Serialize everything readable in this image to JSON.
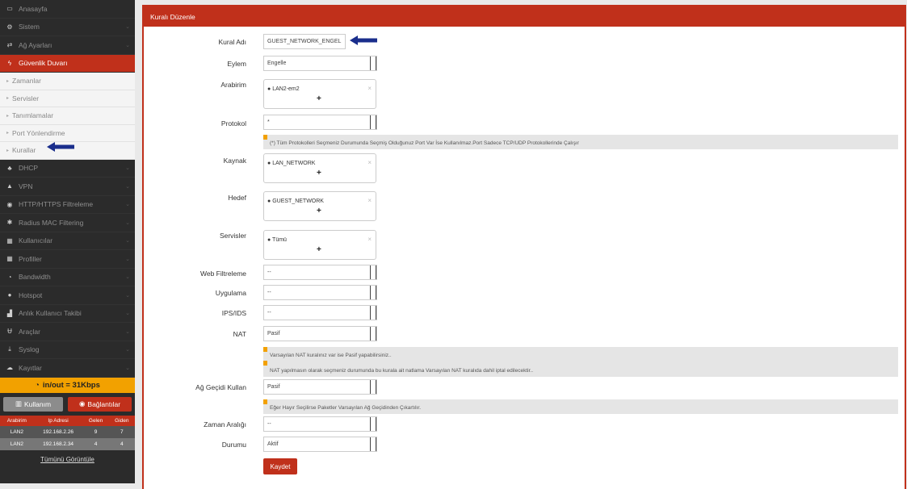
{
  "sidebar": {
    "items": [
      {
        "label": "Anasayfa",
        "icon": "desktop-icon",
        "glyph": "▭"
      },
      {
        "label": "Sistem",
        "icon": "cogs-icon",
        "glyph": "⚙"
      },
      {
        "label": "Ağ Ayarları",
        "icon": "network-icon",
        "glyph": "⇄"
      },
      {
        "label": "Güvenlik Duvarı",
        "icon": "bolt-icon",
        "glyph": "ϟ",
        "active": true
      }
    ],
    "sub_items": [
      {
        "label": "Zamanlar"
      },
      {
        "label": "Servisler"
      },
      {
        "label": "Tanımlamalar"
      },
      {
        "label": "Port Yönlendirme"
      },
      {
        "label": "Kurallar"
      }
    ],
    "items_after": [
      {
        "label": "DHCP",
        "icon": "sitemap-icon",
        "glyph": "♣"
      },
      {
        "label": "VPN",
        "icon": "vpn-icon",
        "glyph": "▲"
      },
      {
        "label": "HTTP/HTTPS Filtreleme",
        "icon": "eye-slash-icon",
        "glyph": "◉"
      },
      {
        "label": "Radius MAC Filtering",
        "icon": "asterisk-icon",
        "glyph": "✱"
      },
      {
        "label": "Kullanıcılar",
        "icon": "users-icon",
        "glyph": "▦"
      },
      {
        "label": "Profiller",
        "icon": "profiles-icon",
        "glyph": "▦"
      },
      {
        "label": "Bandwidth",
        "icon": "dashboard-icon",
        "glyph": "◔"
      },
      {
        "label": "Hotspot",
        "icon": "globe-icon",
        "glyph": "●"
      },
      {
        "label": "Anlık Kullanıcı Takibi",
        "icon": "signal-icon",
        "glyph": "▟"
      },
      {
        "label": "Araçlar",
        "icon": "magnet-icon",
        "glyph": "Ʉ"
      },
      {
        "label": "Syslog",
        "icon": "download-icon",
        "glyph": "⤓"
      },
      {
        "label": "Kayıtlar",
        "icon": "cloud-icon",
        "glyph": "☁"
      }
    ],
    "traffic": "in/out = 31Kbps",
    "usage_button": "Kullanım",
    "connections_button": "Bağlantılar",
    "table": {
      "headers": [
        "Arabirim",
        "Ip Adresi",
        "Gelen",
        "Giden"
      ],
      "rows": [
        [
          "LAN2",
          "192.168.2.26",
          "9",
          "7"
        ],
        [
          "LAN2",
          "192.168.2.34",
          "4",
          "4"
        ]
      ]
    },
    "view_all": "Tümünü Görüntüle"
  },
  "panel": {
    "title": "Kuralı Düzenle",
    "rule_name_label": "Kural Adı",
    "rule_name_value": "GUEST_NETWORK_ENGEL",
    "action_label": "Eylem",
    "action_value": "Engelle",
    "interface_label": "Arabirim",
    "interface_value": "LAN2-em2",
    "protocol_label": "Protokol",
    "protocol_value": "*",
    "protocol_note": "(*) Tüm Protokolleri Seçmeniz Durumunda Seçmiş Olduğunuz Port Var İse Kullanılmaz.Port Sadece TCP/UDP Protokollerinde Çalışır",
    "source_label": "Kaynak",
    "source_value": "LAN_NETWORK",
    "dest_label": "Hedef",
    "dest_value": "GUEST_NETWORK",
    "services_label": "Servisler",
    "services_value": "Tümü",
    "web_filter_label": "Web Filtreleme",
    "web_filter_value": "--",
    "app_label": "Uygulama",
    "app_value": "--",
    "ips_label": "IPS/IDS",
    "ips_value": "--",
    "nat_label": "NAT",
    "nat_value": "Pasif",
    "nat_note_1": "Varsayılan NAT kuralınız var ise Pasif yapabilirsiniz..",
    "nat_note_2": "NAT yapılmasın olarak seçmeniz durumunda bu kurala ait natlama Varsayılan NAT kuralıda dahil iptal edilecektir..",
    "gateway_label": "Ağ Geçidi Kullan",
    "gateway_value": "Pasif",
    "gateway_note": "Eğer Hayır Seçilirse Paketler Varsayılan Ağ Geçidinden Çıkartılır.",
    "time_label": "Zaman Aralığı",
    "time_value": "--",
    "status_label": "Durumu",
    "status_value": "Aktif",
    "save_label": "Kaydet"
  },
  "colors": {
    "accent": "#c0301b",
    "sidebar": "#2b2b2b",
    "traffic": "#f2a100",
    "arrow": "#1a2e8c"
  }
}
